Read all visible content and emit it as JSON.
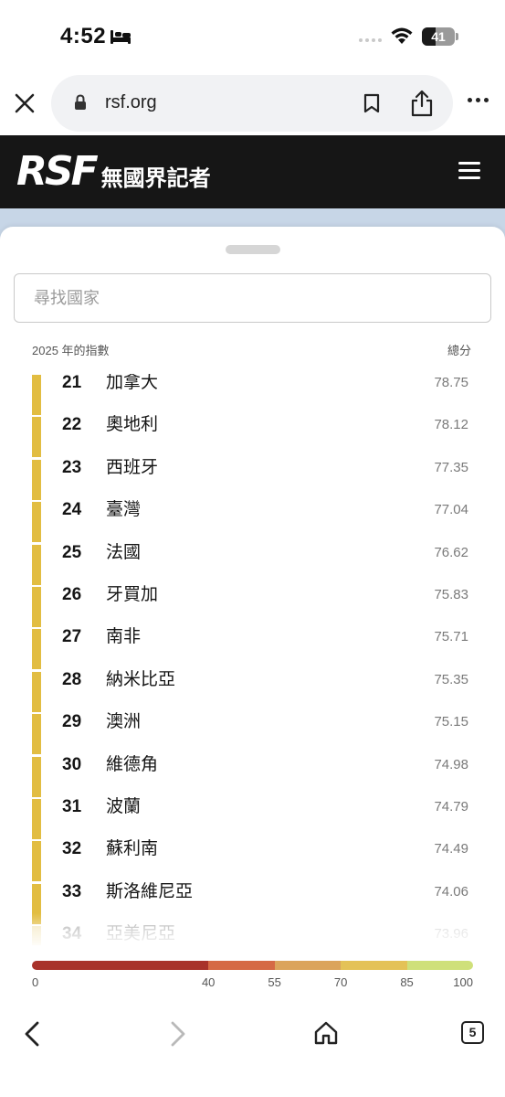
{
  "status_bar": {
    "time": "4:52",
    "battery_percent": "41",
    "battery_level": 0.41,
    "icons": [
      "bed-icon",
      "signal-dots",
      "wifi-icon",
      "battery-icon"
    ]
  },
  "browser": {
    "url": "rsf.org",
    "icons": [
      "close-icon",
      "lock-icon",
      "bookmark-icon",
      "share-icon",
      "more-icon"
    ]
  },
  "site": {
    "logo_text": "RSF",
    "logo_subtitle": "無國界記者",
    "menu_icon": "hamburger-icon"
  },
  "panel": {
    "search_placeholder": "尋找國家",
    "index_label": "2025 年的指數",
    "score_label": "總分",
    "accent_color": "#e2bd42",
    "rows": [
      {
        "rank": "21",
        "country": "加拿大",
        "score": "78.75"
      },
      {
        "rank": "22",
        "country": "奧地利",
        "score": "78.12"
      },
      {
        "rank": "23",
        "country": "西班牙",
        "score": "77.35"
      },
      {
        "rank": "24",
        "country": "臺灣",
        "score": "77.04"
      },
      {
        "rank": "25",
        "country": "法國",
        "score": "76.62"
      },
      {
        "rank": "26",
        "country": "牙買加",
        "score": "75.83"
      },
      {
        "rank": "27",
        "country": "南非",
        "score": "75.71"
      },
      {
        "rank": "28",
        "country": "納米比亞",
        "score": "75.35"
      },
      {
        "rank": "29",
        "country": "澳洲",
        "score": "75.15"
      },
      {
        "rank": "30",
        "country": "維德角",
        "score": "74.98"
      },
      {
        "rank": "31",
        "country": "波蘭",
        "score": "74.79"
      },
      {
        "rank": "32",
        "country": "蘇利南",
        "score": "74.49"
      },
      {
        "rank": "33",
        "country": "斯洛維尼亞",
        "score": "74.06"
      },
      {
        "rank": "34",
        "country": "亞美尼亞",
        "score": "73.96"
      }
    ],
    "legend": {
      "segments": [
        {
          "from": 0,
          "to": 40,
          "color": "#a8322a"
        },
        {
          "from": 40,
          "to": 55,
          "color": "#d56a45"
        },
        {
          "from": 55,
          "to": 70,
          "color": "#dba45c"
        },
        {
          "from": 70,
          "to": 85,
          "color": "#e4c257"
        },
        {
          "from": 85,
          "to": 100,
          "color": "#cfe07a"
        }
      ],
      "ticks": [
        "0",
        "40",
        "55",
        "70",
        "85",
        "100"
      ]
    }
  },
  "bottom_nav": {
    "tab_count": "5",
    "icons": [
      "back-icon",
      "forward-icon",
      "home-icon",
      "tabs-icon"
    ]
  }
}
